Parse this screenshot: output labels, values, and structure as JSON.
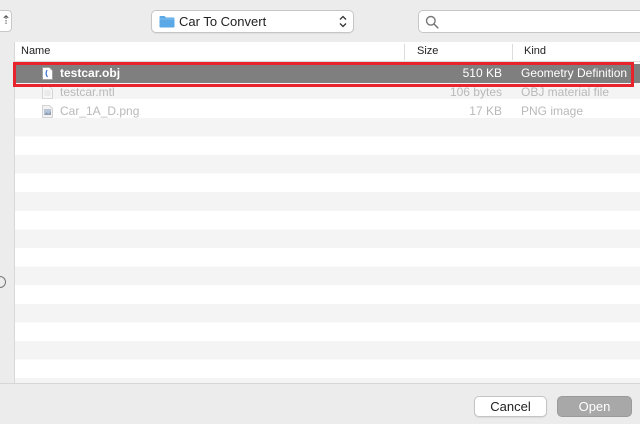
{
  "toolbar": {
    "left_stub_glyph": "⇡",
    "location": {
      "label": "Car To Convert",
      "icon": "folder-icon"
    },
    "search": {
      "placeholder": "",
      "value": ""
    }
  },
  "file_list": {
    "columns": {
      "name": "Name",
      "size": "Size",
      "kind": "Kind"
    },
    "rows": [
      {
        "name": "testcar.obj",
        "size": "510 KB",
        "kind": "Geometry Definition",
        "icon": "document-icon",
        "state": "selected"
      },
      {
        "name": "testcar.mtl",
        "size": "106 bytes",
        "kind": "OBJ material file",
        "icon": "document-icon",
        "state": "disabled"
      },
      {
        "name": "Car_1A_D.png",
        "size": "17 KB",
        "kind": "PNG image",
        "icon": "image-icon",
        "state": "disabled"
      }
    ]
  },
  "buttons": {
    "cancel": "Cancel",
    "open": "Open"
  },
  "colors": {
    "selection": "#7f7f7f",
    "highlight": "#e8232b",
    "folder": "#5aa9e6"
  }
}
